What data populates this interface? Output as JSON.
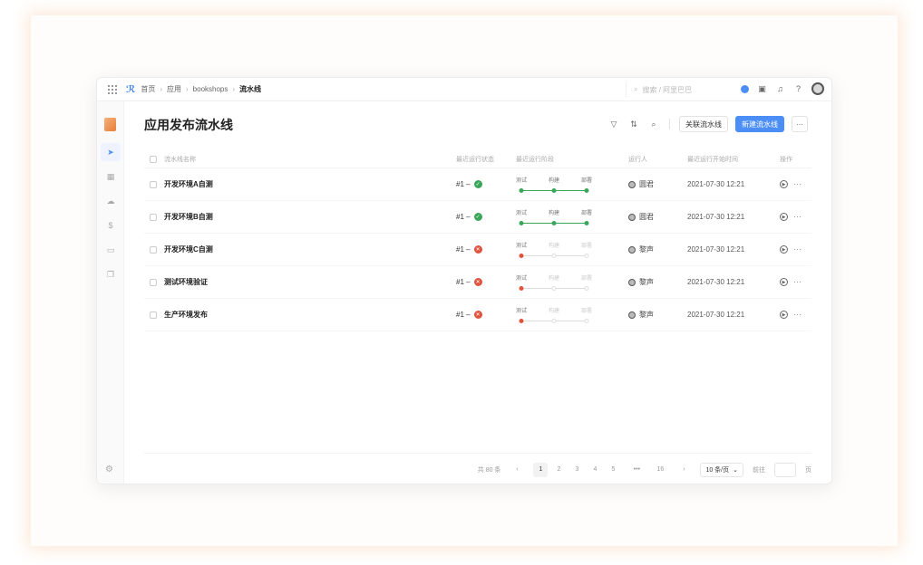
{
  "breadcrumb": {
    "home": "首页",
    "app": "应用",
    "project": "bookshops",
    "current": "流水线"
  },
  "search": {
    "placeholder": "搜索 / 阿里巴巴"
  },
  "page": {
    "title": "应用发布流水线"
  },
  "toolbar": {
    "link_label": "关联流水线",
    "new_label": "新建流水线",
    "more": "···"
  },
  "table": {
    "headers": {
      "name": "流水线名称",
      "status": "最近运行状态",
      "stage": "最近运行阶段",
      "runner": "运行人",
      "time": "最近运行开始时间",
      "ops": "操作"
    },
    "stage_names": [
      "测试",
      "构建",
      "部署"
    ],
    "rows": [
      {
        "name": "开发环境A自测",
        "run": "#1 –",
        "status": "success",
        "stage_reached": 3,
        "runner": "圆君",
        "time": "2021-07-30 12:21"
      },
      {
        "name": "开发环境B自测",
        "run": "#1 –",
        "status": "success",
        "stage_reached": 3,
        "runner": "圆君",
        "time": "2021-07-30 12:21"
      },
      {
        "name": "开发环境C自测",
        "run": "#1 –",
        "status": "failed",
        "stage_reached": 1,
        "runner": "黎声",
        "time": "2021-07-30 12:21"
      },
      {
        "name": "测试环境验证",
        "run": "#1 –",
        "status": "failed",
        "stage_reached": 1,
        "runner": "黎声",
        "time": "2021-07-30 12:21"
      },
      {
        "name": "生产环境发布",
        "run": "#1 –",
        "status": "failed",
        "stage_reached": 1,
        "runner": "黎声",
        "time": "2021-07-30 12:21"
      }
    ]
  },
  "pagination": {
    "total": "共 80 条",
    "pages": [
      "1",
      "2",
      "3",
      "4",
      "5"
    ],
    "ellipsis": "•••",
    "last": "16",
    "current": "1",
    "page_size": "10 条/页",
    "goto_label": "前往",
    "goto_suffix": "页"
  },
  "colors": {
    "primary": "#4c8ef7",
    "success": "#3aa65a",
    "failed": "#e0533d",
    "inactive": "#dddddd"
  },
  "icons": {
    "topbar": [
      "apps-grid-icon",
      "logo-icon",
      "search-icon",
      "status-dot-icon",
      "window-icon",
      "bell-icon",
      "help-icon",
      "avatar"
    ],
    "sidebar": [
      "app-icon",
      "rocket-icon",
      "dashboard-icon",
      "cloud-icon",
      "dollar-icon",
      "box-icon",
      "copy-icon",
      "settings-icon"
    ],
    "toolbar": [
      "filter-icon",
      "sort-icon",
      "search-icon"
    ]
  }
}
